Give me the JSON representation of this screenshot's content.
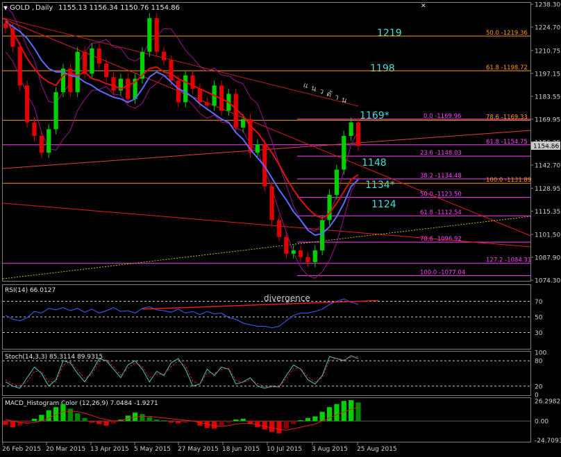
{
  "chart_data": [
    {
      "type": "line",
      "panel": "price",
      "header": {
        "symbol": "GOLD",
        "separator": ",",
        "timeframe": "Daily",
        "ohlc": "1155.13 1156.34 1150.76 1154.86"
      },
      "current_price": "1154.86",
      "ylim": [
        1074.3,
        1238.3
      ],
      "y_ticks": [
        "1238.30",
        "1224.70",
        "1210.75",
        "1197.15",
        "1183.55",
        "1169.95",
        "1156.35",
        "1142.70",
        "1128.95",
        "1115.35",
        "1101.50",
        "1087.90",
        "1074.30"
      ],
      "x_ticks": [
        "26 Feb 2015",
        "20 Mar 2015",
        "13 Apr 2015",
        "5 May 2015",
        "27 May 2015",
        "18 Jun 2015",
        "10 Jul 2015",
        "3 Aug 2015",
        "25 Aug 2015"
      ],
      "series": [
        {
          "values": [
            1224,
            1213,
            1190,
            1168,
            1160,
            1150,
            1164,
            1186,
            1200,
            1186,
            1210,
            1197,
            1212,
            1203,
            1195,
            1187,
            1194,
            1182,
            1194,
            1210,
            1230,
            1210,
            1205,
            1193,
            1180,
            1196,
            1188,
            1180,
            1178,
            1190,
            1175,
            1185,
            1165,
            1170,
            1150,
            1155,
            1130,
            1110,
            1100,
            1090,
            1092,
            1088,
            1085,
            1092,
            1110,
            1125,
            1140,
            1160,
            1168,
            1154
          ]
        },
        {
          "values": [
            1228,
            1225,
            1222,
            1218,
            1212,
            1205,
            1200,
            1198,
            1198,
            1196,
            1195,
            1192,
            1190,
            1187,
            1185,
            1183,
            1182,
            1180,
            1182,
            1188,
            1195,
            1198,
            1196,
            1192,
            1188,
            1186,
            1183,
            1179,
            1176,
            1173,
            1170,
            1168,
            1162,
            1158,
            1152,
            1147,
            1142,
            1135,
            1128,
            1122,
            1115,
            1110,
            1104,
            1101,
            1102,
            1106,
            1112,
            1120,
            1130,
            1134
          ]
        },
        {
          "values": [
            1230,
            1222,
            1214,
            1206,
            1200,
            1195,
            1192,
            1190,
            1196,
            1197,
            1196,
            1198,
            1194,
            1193,
            1191,
            1190,
            1188,
            1190,
            1192,
            1196,
            1200,
            1201,
            1198,
            1197,
            1194,
            1192,
            1190,
            1188,
            1186,
            1184,
            1182,
            1180,
            1176,
            1172,
            1166,
            1162,
            1156,
            1150,
            1143,
            1135,
            1128,
            1122,
            1117,
            1113,
            1111,
            1114,
            1120,
            1127,
            1134,
            1137
          ]
        }
      ],
      "fibonacci_levels": [
        "50.0 -1219.36",
        "61.8 -1198.72",
        "0.0 -1169.96",
        "78.6 -1169.33",
        "61.8 -1154.75",
        "23.6 -1148.03",
        "38.2 -1134.48",
        "100.0 -1131.89",
        "50.0 -1123.50",
        "61.8 -1112.54",
        "78.6 -1096.92",
        "127.2 -1084.31",
        "100.0 -1077.04"
      ],
      "annotations": [
        "1219",
        "1198",
        "1169*",
        "1148",
        "1134*",
        "1124"
      ],
      "thai_label": "แนวต้าน"
    },
    {
      "type": "line",
      "panel": "rsi",
      "label": "RSI(14) 66.0127",
      "ylim": [
        10,
        90
      ],
      "y_ticks": [
        "70",
        "50",
        "30"
      ],
      "annotation": "divergence",
      "values": [
        52,
        47,
        45,
        49,
        57,
        55,
        61,
        59,
        62,
        58,
        61,
        56,
        60,
        55,
        58,
        62,
        57,
        58,
        55,
        61,
        63,
        59,
        58,
        56,
        60,
        55,
        57,
        53,
        57,
        54,
        55,
        49,
        47,
        42,
        40,
        38,
        38,
        36,
        38,
        45,
        52,
        55,
        55,
        57,
        60,
        66,
        70,
        73,
        69,
        66
      ]
    },
    {
      "type": "line",
      "panel": "stochastic",
      "label": "Stoch(14,3,3) 85.3114 89.9315",
      "ylim": [
        0,
        100
      ],
      "y_ticks": [
        "100",
        "80",
        "20",
        "0"
      ],
      "series": [
        {
          "values": [
            30,
            20,
            15,
            40,
            65,
            50,
            20,
            35,
            80,
            75,
            50,
            30,
            55,
            85,
            80,
            60,
            40,
            70,
            80,
            60,
            30,
            55,
            45,
            75,
            85,
            60,
            20,
            25,
            60,
            45,
            65,
            60,
            25,
            30,
            40,
            20,
            15,
            20,
            18,
            45,
            70,
            60,
            35,
            25,
            45,
            90,
            85,
            80,
            92,
            85
          ]
        },
        {
          "values": [
            35,
            25,
            20,
            30,
            55,
            55,
            30,
            30,
            70,
            78,
            58,
            38,
            48,
            78,
            82,
            66,
            46,
            62,
            76,
            66,
            40,
            48,
            48,
            66,
            80,
            68,
            32,
            24,
            52,
            50,
            60,
            62,
            34,
            28,
            36,
            26,
            18,
            18,
            18,
            38,
            62,
            62,
            42,
            30,
            40,
            80,
            86,
            82,
            88,
            90
          ]
        }
      ]
    },
    {
      "type": "bar",
      "panel": "macd",
      "label": "MACD_Histogram Color (12,26,9) 7.0484 -1.9271",
      "ylim": [
        -26.0,
        28.0
      ],
      "y_ticks": [
        "26.2982",
        "0.00",
        "-24.7093"
      ],
      "values": [
        -5,
        -8,
        -6,
        -2,
        3,
        8,
        14,
        18,
        22,
        16,
        10,
        4,
        -2,
        -4,
        -6,
        -3,
        2,
        7,
        11,
        9,
        5,
        2,
        1,
        -2,
        -3,
        -2,
        -1,
        -6,
        -9,
        -10,
        -6,
        -2,
        2,
        3,
        -4,
        -8,
        -11,
        -14,
        -16,
        -10,
        -4,
        1,
        4,
        6,
        12,
        18,
        22,
        26,
        27,
        24
      ],
      "signal": [
        2,
        0,
        -2,
        -3,
        -2,
        0,
        4,
        8,
        12,
        13,
        12,
        10,
        7,
        4,
        2,
        0,
        1,
        3,
        5,
        6,
        6,
        5,
        4,
        3,
        2,
        1,
        0,
        -2,
        -4,
        -6,
        -7,
        -6,
        -4,
        -3,
        -3,
        -5,
        -7,
        -9,
        -11,
        -12,
        -10,
        -8,
        -6,
        -4,
        0,
        4,
        8,
        12,
        15,
        18
      ]
    }
  ],
  "colors": {
    "background": "#000000",
    "grid": "#c8c8c8",
    "bull": "#00d000",
    "bear": "#e00000",
    "ma_fast": "#5b6cff",
    "ma_slow": "#e01010",
    "fib": "#ff40ff",
    "cyan_text": "#40e0e0",
    "orange": "#ff9a00"
  }
}
